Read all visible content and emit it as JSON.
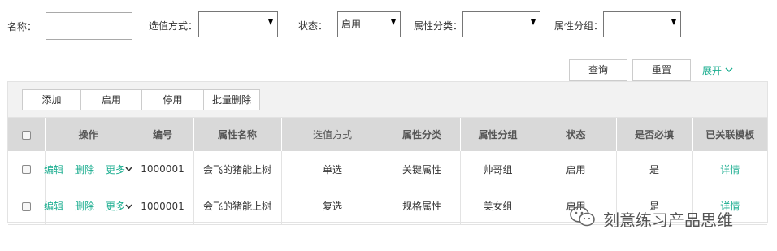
{
  "filters": {
    "name_label": "名称：",
    "name_value": "",
    "selection_label": "选值方式：",
    "selection_value": "",
    "status_label": "状态：",
    "status_value": "启用",
    "category_label": "属性分类：",
    "category_value": "",
    "group_label": "属性分组：",
    "group_value": ""
  },
  "actions": {
    "query": "查询",
    "reset": "重置",
    "expand": "展开"
  },
  "toolbar": {
    "add": "添加",
    "enable": "启用",
    "disable": "停用",
    "batch_delete": "批量删除"
  },
  "table": {
    "headers": [
      "操作",
      "编号",
      "属性名称",
      "选值方式",
      "属性分类",
      "属性分组",
      "状态",
      "是否必填",
      "已关联模板"
    ],
    "op_labels": {
      "edit": "编辑",
      "delete": "删除",
      "more": "更多"
    },
    "rows": [
      {
        "id": "1000001",
        "name": "会飞的猪能上树",
        "selection": "单选",
        "category": "关键属性",
        "group": "帅哥组",
        "status": "启用",
        "required": "是",
        "template": "详情"
      },
      {
        "id": "1000001",
        "name": "会飞的猪能上树",
        "selection": "复选",
        "category": "规格属性",
        "group": "美女组",
        "status": "启用",
        "required": "是",
        "template": "详情"
      }
    ]
  },
  "watermark": {
    "text": "刻意练习产品思维",
    "icon": "wechat-icon"
  },
  "colors": {
    "accent": "#1aad8f",
    "header_bg": "#d9d9d9",
    "toolbar_bg": "#f2f2f2"
  }
}
